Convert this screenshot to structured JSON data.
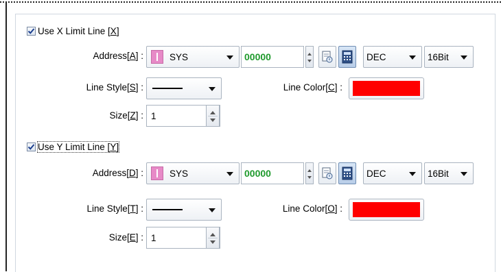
{
  "x_limit": {
    "checkbox": {
      "label_pre": "Use X  Limit Line [",
      "label_key": "X",
      "label_post": "]",
      "checked": true
    },
    "address": {
      "label_pre": "Address[",
      "label_key": "A",
      "label_post": "] :",
      "device": "SYS",
      "value": "00000",
      "format": "DEC",
      "bits": "16Bit"
    },
    "line_style": {
      "label_pre": "Line Style[",
      "label_key": "S",
      "label_post": "] :"
    },
    "line_color": {
      "label_pre": "Line Color[",
      "label_key": "C",
      "label_post": "] :",
      "color": "#ff0000"
    },
    "size": {
      "label_pre": "Size[",
      "label_key": "Z",
      "label_post": "] :",
      "value": "1"
    }
  },
  "y_limit": {
    "checkbox": {
      "label_pre": "Use Y  Limit Line [",
      "label_key": "Y",
      "label_post": "]",
      "checked": true
    },
    "address": {
      "label_pre": "Address[",
      "label_key": "D",
      "label_post": "] :",
      "device": "SYS",
      "value": "00000",
      "format": "DEC",
      "bits": "16Bit"
    },
    "line_style": {
      "label_pre": "Line Style[",
      "label_key": "T",
      "label_post": "] :"
    },
    "line_color": {
      "label_pre": "Line Color[",
      "label_key": "O",
      "label_post": "] :",
      "color": "#ff0000"
    },
    "size": {
      "label_pre": "Size[",
      "label_key": "E",
      "label_post": "] :",
      "value": "1"
    }
  },
  "icons": {
    "checkmark": "check-icon",
    "device_chip": "device-type-icon",
    "address_picker": "address-picker-icon",
    "keypad": "keypad-icon",
    "dropdown": "chevron-down-icon"
  }
}
